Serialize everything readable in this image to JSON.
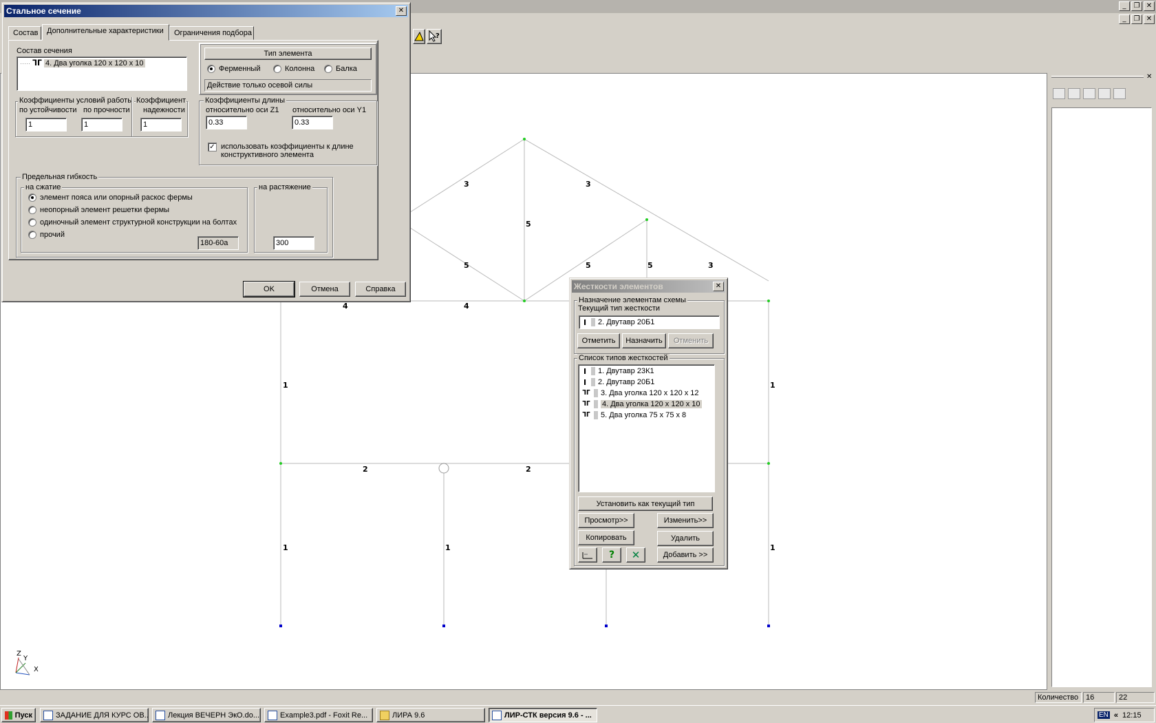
{
  "app": {
    "taskbar": {
      "start_label": "Пуск",
      "tasks": [
        "ЗАДАНИЕ ДЛЯ КУРС ОВ...",
        "Лекция ВЕЧЕРН ЭкО.do...",
        "Example3.pdf - Foxit Re...",
        "ЛИРА 9.6",
        "ЛИР-СТК версия 9.6 - ..."
      ],
      "lang": "EN",
      "clock": "12:15"
    },
    "status": {
      "label": "Количество",
      "value1": "16",
      "value2": "22"
    }
  },
  "canvas": {
    "element_labels": [
      "3",
      "3",
      "5",
      "5",
      "5",
      "5",
      "3",
      "4",
      "4",
      "1",
      "1",
      "2",
      "2",
      "1",
      "1",
      "1"
    ],
    "axis": {
      "z": "Z",
      "y": "Y",
      "x": "X"
    }
  },
  "steel_dialog": {
    "title": "Стальное сечение",
    "tabs": [
      "Состав",
      "Дополнительные характеристики",
      "Ограничения подбора"
    ],
    "composition": {
      "label": "Состав сечения",
      "item": "4. Два уголка 120 x 120 x 10"
    },
    "element_type": {
      "label": "Тип элемента",
      "options": [
        "Ферменный",
        "Колонна",
        "Балка"
      ],
      "selected": "Ферменный",
      "note": "Действие только осевой силы"
    },
    "work_coeffs": {
      "label": "Коэффициенты условий работы",
      "stability_label": "по устойчивости",
      "stability_value": "1",
      "strength_label": "по прочности",
      "strength_value": "1",
      "reliability_label_1": "Коэффициент",
      "reliability_label_2": "надежности",
      "reliability_value": "1"
    },
    "length_coeffs": {
      "label": "Коэффициенты длины",
      "z1_label": "относительно оси Z1",
      "z1_value": "0.33",
      "y1_label": "относительно оси Y1",
      "y1_value": "0.33",
      "checkbox_label_1": "использовать коэффициенты к длине",
      "checkbox_label_2": "конструктивного элемента",
      "checked": true
    },
    "slenderness": {
      "label": "Предельная гибкость",
      "compression_label": "на сжатие",
      "options": [
        "элемент пояса или опорный раскос фермы",
        "неопорный элемент решетки фермы",
        "одиночный элемент структурной конструкции на болтах",
        "прочий"
      ],
      "selected_index": 0,
      "compression_value": "180-60a",
      "tension_label": "на растяжение",
      "tension_value": "300"
    },
    "buttons": {
      "ok": "OK",
      "cancel": "Отмена",
      "help": "Справка"
    }
  },
  "stiffness_dialog": {
    "title": "Жесткости элементов",
    "assign_group": "Назначение элементам схемы",
    "current_label": "Текущий тип жесткости",
    "current_value": "2. Двутавр 20Б1",
    "buttons_top": {
      "mark": "Отметить",
      "assign": "Назначить",
      "undo": "Отменить"
    },
    "list_label": "Список типов жесткостей",
    "items": [
      {
        "icon": "I",
        "label": "1. Двутавр 23К1"
      },
      {
        "icon": "I",
        "label": "2. Двутавр 20Б1"
      },
      {
        "icon": "ᒣᒥ",
        "label": "3. Два уголка 120 x 120 x 12"
      },
      {
        "icon": "ᒣᒥ",
        "label": "4. Два уголка 120 x 120 x 10"
      },
      {
        "icon": "ᒣᒥ",
        "label": "5. Два уголка 75 x 75 x 8"
      }
    ],
    "selected_index": 3,
    "buttons": {
      "set_current": "Установить как текущий тип",
      "view": "Просмотр>>",
      "edit": "Изменить>>",
      "copy": "Копировать",
      "delete": "Удалить",
      "add": "Добавить >>"
    }
  }
}
